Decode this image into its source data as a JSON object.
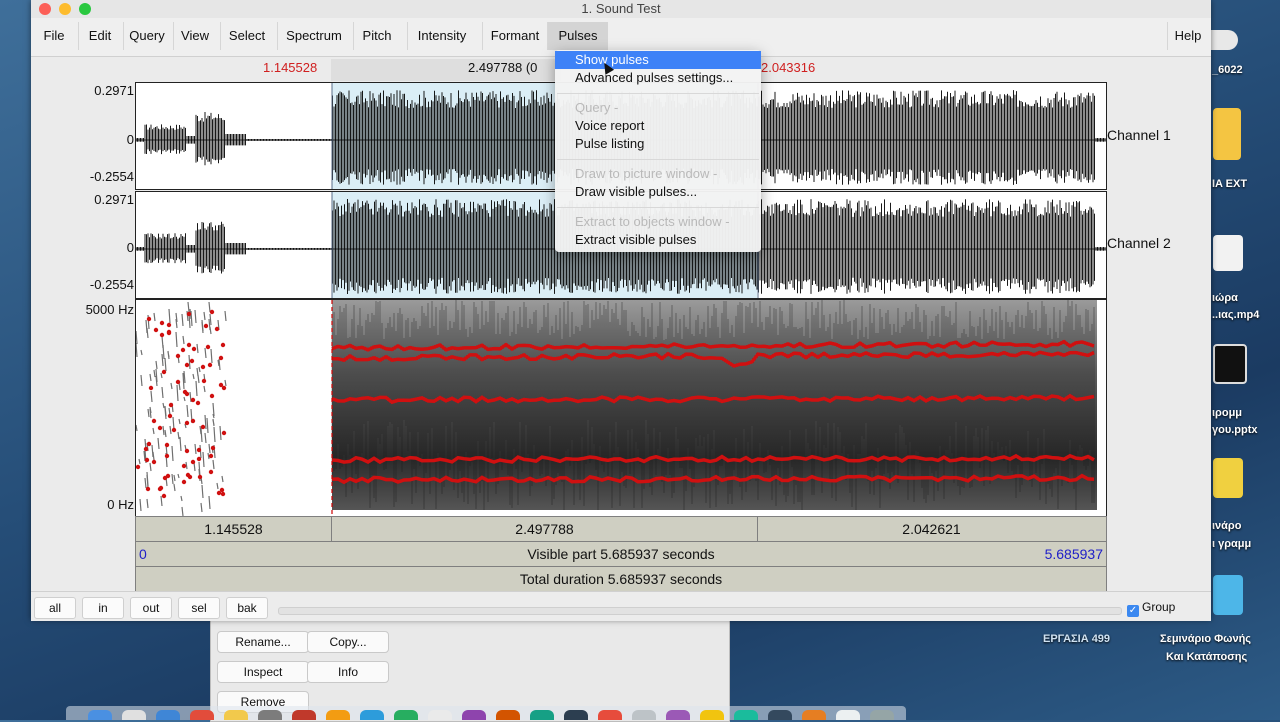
{
  "window": {
    "title": "1. Sound Test"
  },
  "menu": {
    "items": [
      "File",
      "Edit",
      "Query",
      "View",
      "Select",
      "Spectrum",
      "Pitch",
      "Intensity",
      "Formant",
      "Pulses"
    ],
    "help": "Help"
  },
  "selection": {
    "left": "1.145528",
    "mid": "2.497788 (0",
    "right": "2.043316"
  },
  "channels": [
    {
      "max": "0.2971",
      "zero": "0",
      "min": "-0.2554",
      "label": "Channel 1"
    },
    {
      "max": "0.2971",
      "zero": "0",
      "min": "-0.2554",
      "label": "Channel 2"
    }
  ],
  "spectrogram": {
    "top_label": "5000 Hz",
    "bottom_label": "0 Hz"
  },
  "durations": [
    "1.145528",
    "2.497788",
    "2.042621"
  ],
  "visible": {
    "start": "0",
    "text": "Visible part 5.685937 seconds",
    "end": "5.685937"
  },
  "total": "Total duration 5.685937 seconds",
  "bottom": {
    "buttons": [
      "all",
      "in",
      "out",
      "sel",
      "bak"
    ],
    "group_label": "Group"
  },
  "pulses_menu": [
    {
      "label": "Show pulses",
      "state": "highlight"
    },
    {
      "label": "Advanced pulses settings...",
      "state": "normal"
    },
    {
      "label": "Query -",
      "state": "disabled"
    },
    {
      "label": "Voice report",
      "state": "normal"
    },
    {
      "label": "Pulse listing",
      "state": "normal"
    },
    {
      "label": "Draw to picture window -",
      "state": "disabled"
    },
    {
      "label": "Draw visible pulses...",
      "state": "normal"
    },
    {
      "label": "Extract to objects window -",
      "state": "disabled"
    },
    {
      "label": "Extract visible pulses",
      "state": "normal"
    }
  ],
  "back_window": {
    "buttons": [
      "Rename...",
      "Copy...",
      "Inspect",
      "Info",
      "Remove"
    ]
  },
  "desktop": {
    "labels": [
      "_6022",
      "IA EXT",
      "ιώρα",
      "..ιας.mp4",
      "ιρομμ",
      "γου.pptx",
      "ινάρο",
      "ι γραμμ",
      "ΕΡΓΑΣΙΑ 499",
      "Σεμινάριο Φωνής",
      "Και Κατάποσης"
    ]
  },
  "colors": {
    "menu_highlight": "#3e82f7",
    "selection_red": "#d02020",
    "visible_end_blue": "#2020c8",
    "formant_track": "#d01010"
  }
}
